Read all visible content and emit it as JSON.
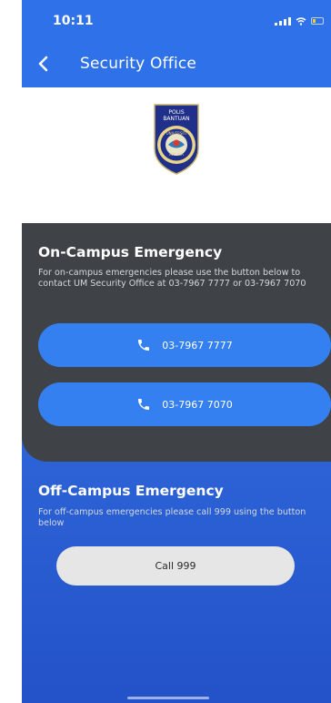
{
  "status_bar": {
    "time": "10:11"
  },
  "header": {
    "title": "Security Office",
    "back_icon": "chevron-left-icon"
  },
  "logo": {
    "alt": "Polis Bantuan Universiti Malaya crest",
    "top_text": "POLIS BANTUAN",
    "ring_text": "UNIVERSITI MALAYA"
  },
  "on_campus": {
    "title": "On-Campus Emergency",
    "description": "For on-campus emergencies please use the button below to contact UM Security Office at 03-7967 7777 or 03-7967 7070",
    "buttons": [
      {
        "label": "03-7967 7777",
        "icon": "phone-icon"
      },
      {
        "label": "03-7967 7070",
        "icon": "phone-icon"
      }
    ]
  },
  "off_campus": {
    "title": "Off-Campus Emergency",
    "description": "For off-campus emergencies please call 999 using the button below",
    "button_label": "Call 999"
  },
  "colors": {
    "header_blue": "#2f71e8",
    "dark_card": "#3f4347",
    "call_button_blue": "#3580f0",
    "call999_button": "#e7e6e6"
  }
}
